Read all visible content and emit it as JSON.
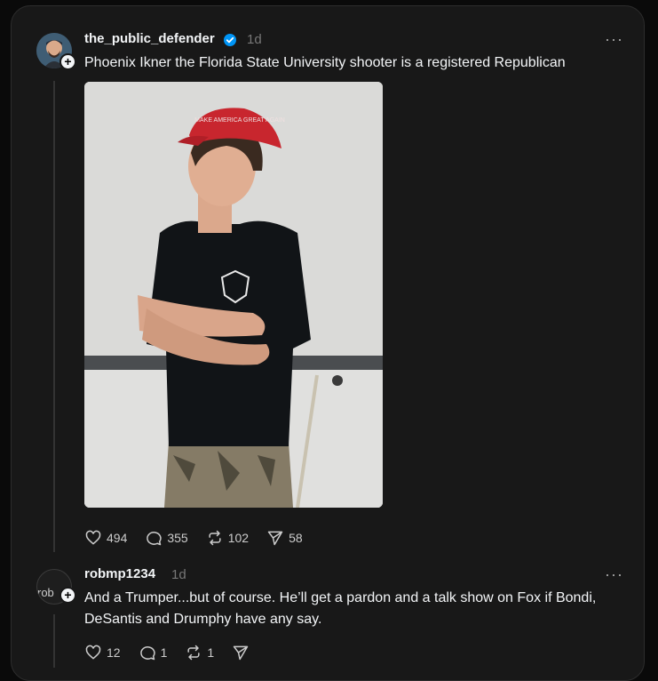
{
  "post": {
    "username": "the_public_defender",
    "time": "1d",
    "text": "Phoenix Ikner the Florida State University shooter is a registered Republican",
    "likes": "494",
    "replies": "355",
    "reposts": "102",
    "shares": "58",
    "hat_text": "MAKE AMERICA GREAT AGAIN"
  },
  "reply": {
    "username": "robmp1234",
    "time": "1d",
    "avatar_alt": "rob",
    "text": "And a Trumper...but of course. He’ll get a pardon and a talk show on Fox if Bondi, DeSantis and Drumphy have any say.",
    "likes": "12",
    "replies": "1",
    "reposts": "1"
  },
  "colors": {
    "verified": "#0095f6",
    "cap": "#c8262e"
  }
}
